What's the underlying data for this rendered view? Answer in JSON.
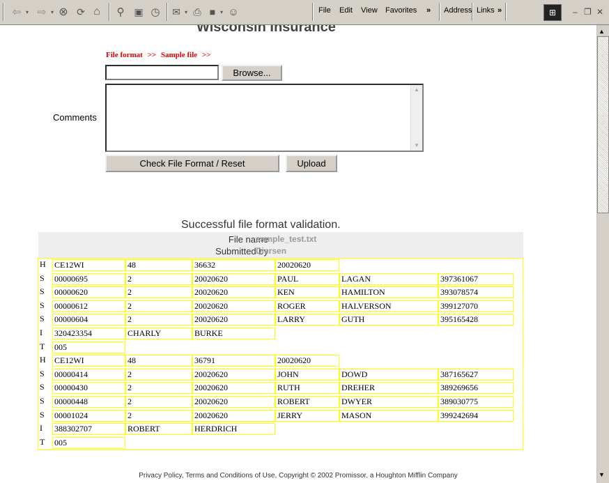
{
  "toolbar": {
    "menus": [
      "File",
      "Edit",
      "View",
      "Favorites"
    ],
    "address_label": "Address",
    "links_label": "Links",
    "chevron": "»"
  },
  "page": {
    "clipped_title": "Wisconsin Insurance",
    "file_format_link": "File format",
    "sample_file_link": "Sample file",
    "link_sep": ">>",
    "file_value": "",
    "browse_label": "Browse...",
    "comments_label": "Comments",
    "comments_value": "",
    "check_label": "Check File Format / Reset",
    "upload_label": "Upload",
    "success_message": "Successful file format validation.",
    "file_name_label": "File name",
    "file_name_value": "sample_test.txt",
    "submitted_by_label": "Submitted by",
    "submitted_by_value": "Diersen"
  },
  "records": [
    [
      "H",
      "CE12WI",
      "48",
      "36632",
      "20020620"
    ],
    [
      "S",
      "00000695",
      "2",
      "20020620",
      "PAUL",
      "LAGAN",
      "397361067"
    ],
    [
      "S",
      "00000620",
      "2",
      "20020620",
      "KEN",
      "HAMILTON",
      "393078574"
    ],
    [
      "S",
      "00000612",
      "2",
      "20020620",
      "ROGER",
      "HALVERSON",
      "399127070"
    ],
    [
      "S",
      "00000604",
      "2",
      "20020620",
      "LARRY",
      "GUTH",
      "395165428"
    ],
    [
      "I",
      "320423354",
      "CHARLY",
      "BURKE"
    ],
    [
      "T",
      "005"
    ],
    [
      "H",
      "CE12WI",
      "48",
      "36791",
      "20020620"
    ],
    [
      "S",
      "00000414",
      "2",
      "20020620",
      "JOHN",
      "DOWD",
      "387165627"
    ],
    [
      "S",
      "00000430",
      "2",
      "20020620",
      "RUTH",
      "DREHER",
      "389269656"
    ],
    [
      "S",
      "00000448",
      "2",
      "20020620",
      "ROBERT",
      "DWYER",
      "389030775"
    ],
    [
      "S",
      "00001024",
      "2",
      "20020620",
      "JERRY",
      "MASON",
      "399242694"
    ],
    [
      "I",
      "388302707",
      "ROBERT",
      "HERDRICH"
    ],
    [
      "T",
      "005"
    ]
  ],
  "footer": "Privacy Policy, Terms and Conditions of Use,  Copyright © 2002 Promissor,  a Houghton Mifflin Company"
}
